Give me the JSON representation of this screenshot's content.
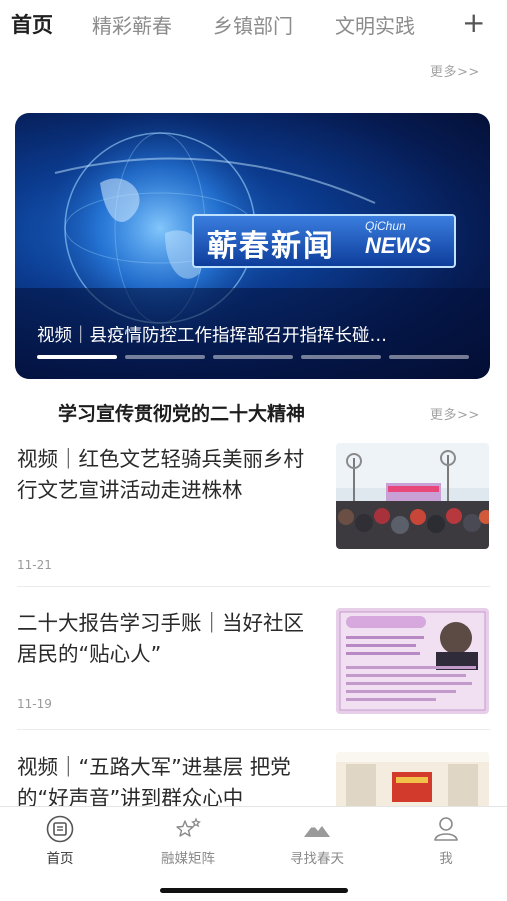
{
  "top_tabs": [
    {
      "label": "首页"
    },
    {
      "label": "精彩蕲春"
    },
    {
      "label": "乡镇部门"
    },
    {
      "label": "文明实践"
    }
  ],
  "add_tab_label": "+",
  "more_label": "更多>>",
  "banner": {
    "caption": "视频｜县疫情防控工作指挥部召开指挥长碰…",
    "logo_cn": "蕲春新闻",
    "logo_en_top": "QiChun",
    "logo_en_bottom": "NEWS",
    "slide_count": 5,
    "active_slide": 1
  },
  "section": {
    "title": "学习宣传贯彻党的二十大精神",
    "more_label": "更多>>"
  },
  "articles": [
    {
      "title": "视频｜红色文艺轻骑兵美丽乡村行文艺宣讲活动走进株林",
      "date": "11-21",
      "thumb": "event-stage-crowd"
    },
    {
      "title": "二十大报告学习手账｜当好社区居民的“贴心人”",
      "date": "11-19",
      "thumb": "study-notebook-poster"
    },
    {
      "title": "视频｜“五路大军”进基层 把党的“好声音”讲到群众心中",
      "date": "",
      "thumb": "meeting-hall"
    }
  ],
  "bottom_tabs": [
    {
      "label": "首页",
      "icon": "home-icon"
    },
    {
      "label": "融媒矩阵",
      "icon": "stars-icon"
    },
    {
      "label": "寻找春天",
      "icon": "mountain-icon"
    },
    {
      "label": "我",
      "icon": "user-icon"
    }
  ],
  "colors": {
    "active_text": "#1f1f1f",
    "inactive_text": "#8c8c8c",
    "banner_blue": "#0b3b8f"
  }
}
